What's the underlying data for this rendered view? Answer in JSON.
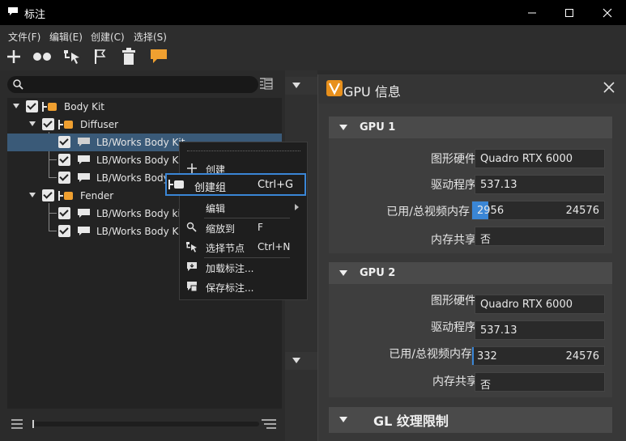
{
  "window": {
    "title": "标注",
    "minimize_icon": "minimize-icon",
    "maximize_icon": "maximize-icon",
    "close_icon": "close-icon"
  },
  "menu": {
    "file": "文件(F)",
    "edit": "编辑(E)",
    "create": "创建(C)",
    "select": "选择(S)"
  },
  "toolbar": [
    "plus-icon",
    "group-dots-icon",
    "select-node-icon",
    "flag-icon",
    "trash-icon",
    "note-icon"
  ],
  "colors": {
    "accent": "#3a86d6",
    "orange": "#f0a030",
    "selection": "#3a5a78"
  },
  "tree": {
    "search_placeholder": "",
    "rows": [
      {
        "label": "Body Kit",
        "type": "group"
      },
      {
        "label": "Diffuser",
        "type": "group"
      },
      {
        "label": "LB/Works Body Kit",
        "type": "note",
        "selected": true
      },
      {
        "label": "LB/Works Body Kit",
        "type": "note"
      },
      {
        "label": "LB/Works Body",
        "type": "note"
      },
      {
        "label": "Fender",
        "type": "group"
      },
      {
        "label": "LB/Works Body kit",
        "type": "note"
      },
      {
        "label": "LB/Works Body Kit",
        "type": "note"
      }
    ]
  },
  "context_menu": {
    "create": "创建",
    "create_group": "创建组",
    "create_group_shortcut": "Ctrl+G",
    "edit": "编辑",
    "zoom_to": "缩放到",
    "zoom_to_shortcut": "F",
    "select_nodes": "选择节点",
    "select_nodes_shortcut": "Ctrl+N",
    "load": "加载标注...",
    "save": "保存标注..."
  },
  "gpu_panel": {
    "title": "GPU 信息",
    "gpu1": {
      "header": "GPU 1",
      "hardware_label": "图形硬件",
      "hardware": "Quadro RTX 6000",
      "driver_label": "驱动程序",
      "driver": "537.13",
      "mem_label": "已用/总视频内存",
      "mem_used": "2956",
      "mem_total": "24576",
      "mem_fraction": 0.12,
      "shared_label": "内存共享",
      "shared": "否"
    },
    "gpu2": {
      "header": "GPU 2",
      "hardware_label": "图形硬件",
      "hardware": "Quadro RTX 6000",
      "driver_label": "驱动程序",
      "driver": "537.13",
      "mem_label": "已用/总视频内存",
      "mem_used": "332",
      "mem_total": "24576",
      "mem_fraction": 0.01,
      "shared_label": "内存共享",
      "shared": "否"
    },
    "gl_header": "GL 纹理限制"
  }
}
